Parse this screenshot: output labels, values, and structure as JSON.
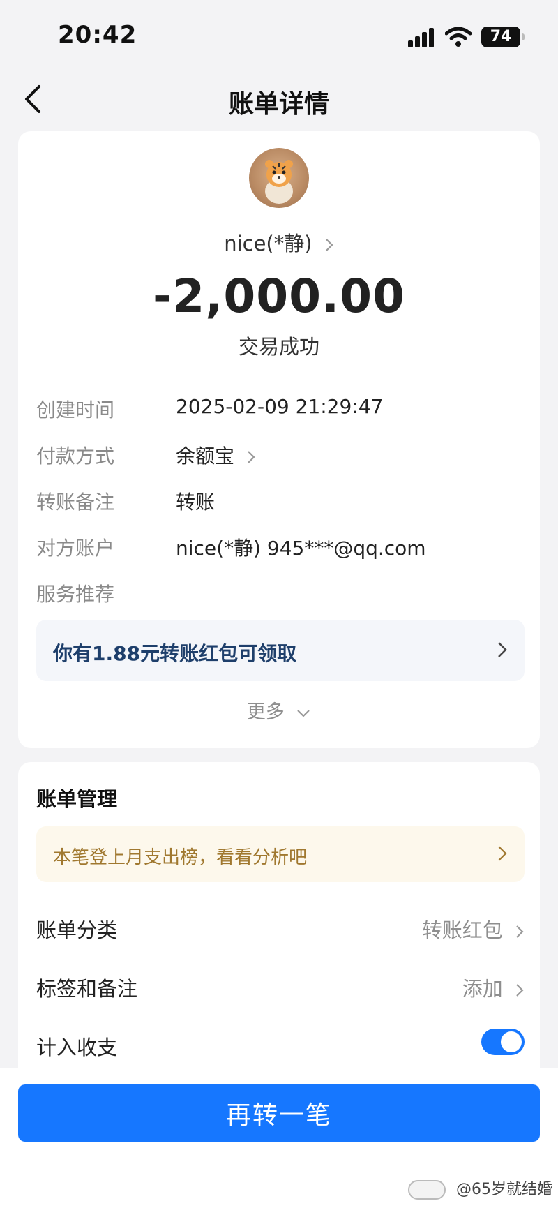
{
  "status_bar": {
    "time": "20:42",
    "battery": "74"
  },
  "nav": {
    "title": "账单详情"
  },
  "transaction": {
    "payee": "nice(*静)",
    "amount": "-2,000.00",
    "status": "交易成功"
  },
  "details": [
    {
      "label": "创建时间",
      "value": "2025-02-09 21:29:47"
    },
    {
      "label": "付款方式",
      "value": "余额宝"
    },
    {
      "label": "转账备注",
      "value": "转账"
    },
    {
      "label": "对方账户",
      "value": "nice(*静) 945***@qq.com"
    },
    {
      "label": "服务推荐",
      "value": ""
    }
  ],
  "promo": {
    "text": "你有1.88元转账红包可领取"
  },
  "more": {
    "label": "更多"
  },
  "manage": {
    "title": "账单管理",
    "tip": "本笔登上月支出榜，看看分析吧",
    "category_label": "账单分类",
    "category_value": "转账红包",
    "tags_label": "标签和备注",
    "tags_value": "添加",
    "count_label": "计入收支",
    "count_enabled": true
  },
  "action": {
    "label": "再转一笔"
  },
  "watermark": {
    "text": "@65岁就结婚"
  },
  "colors": {
    "primary": "#1677ff",
    "promo_text": "#1e3f6b",
    "tip_text": "#a0782f"
  }
}
